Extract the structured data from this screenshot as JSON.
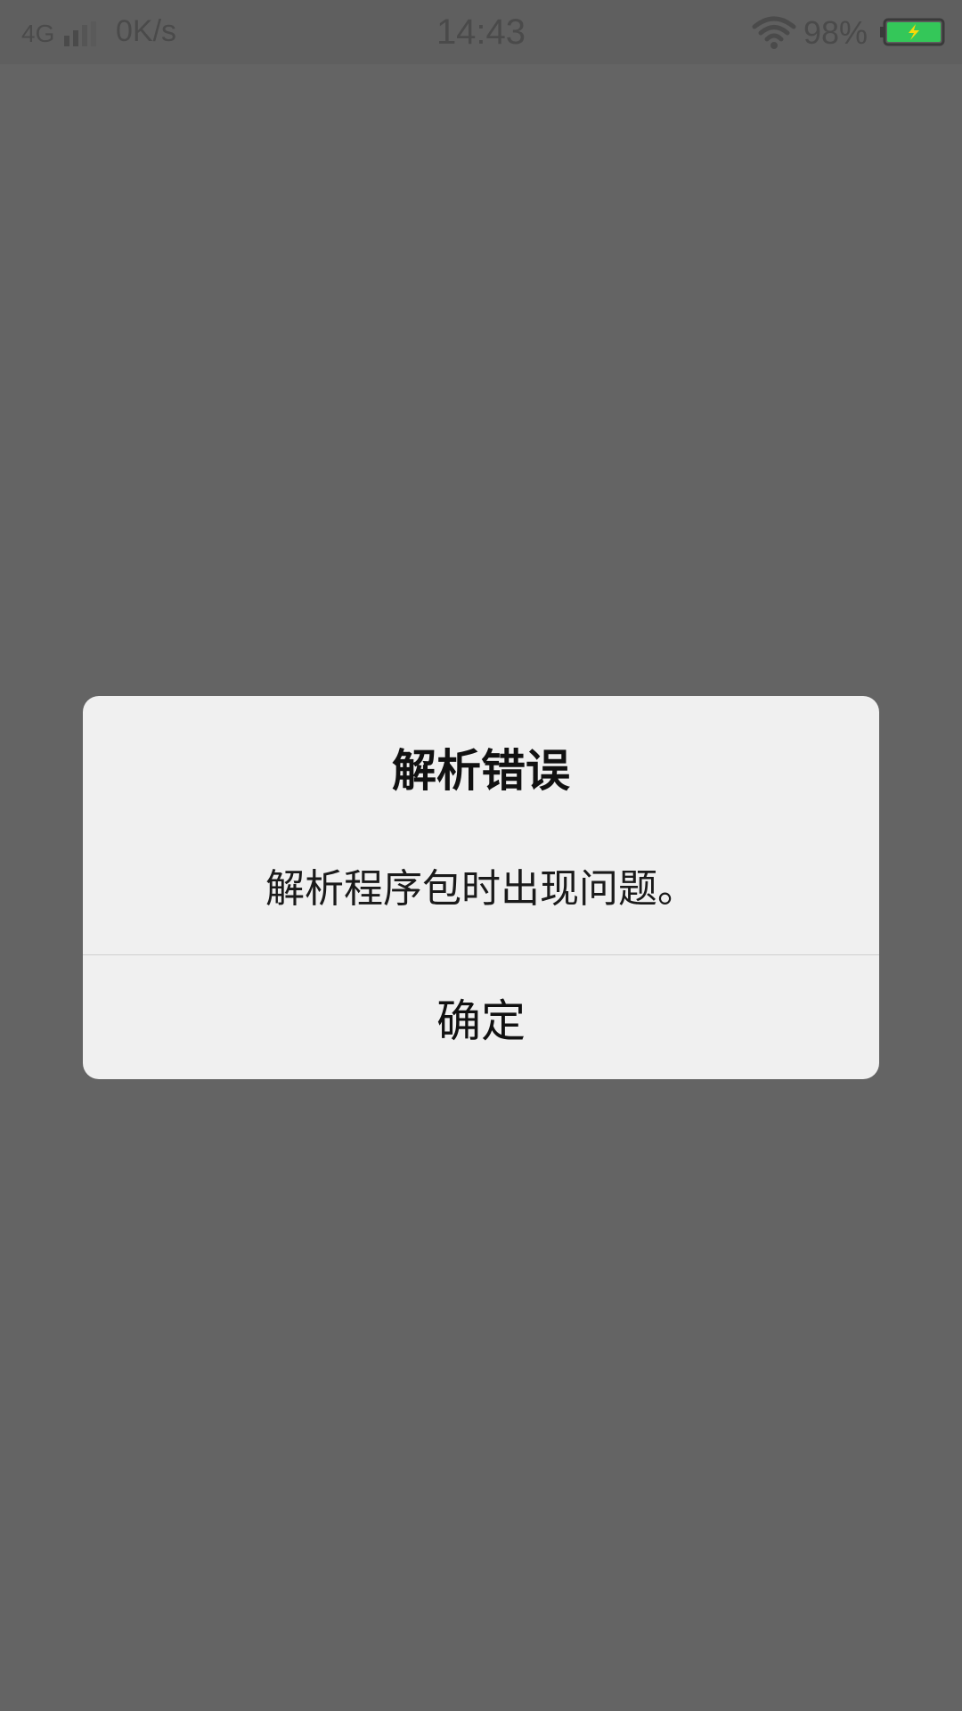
{
  "status_bar": {
    "network": "4G",
    "speed": "0K/s",
    "time": "14:43",
    "battery_percent": "98%",
    "icons": [
      "signal-icon",
      "wifi-icon",
      "battery-charging-icon"
    ],
    "battery_color": "#34c759"
  },
  "dialog": {
    "title": "解析错误",
    "message": "解析程序包时出现问题。",
    "confirm_label": "确定"
  },
  "colors": {
    "overlay": "#646464",
    "dialog_bg": "#f0f0f0"
  }
}
